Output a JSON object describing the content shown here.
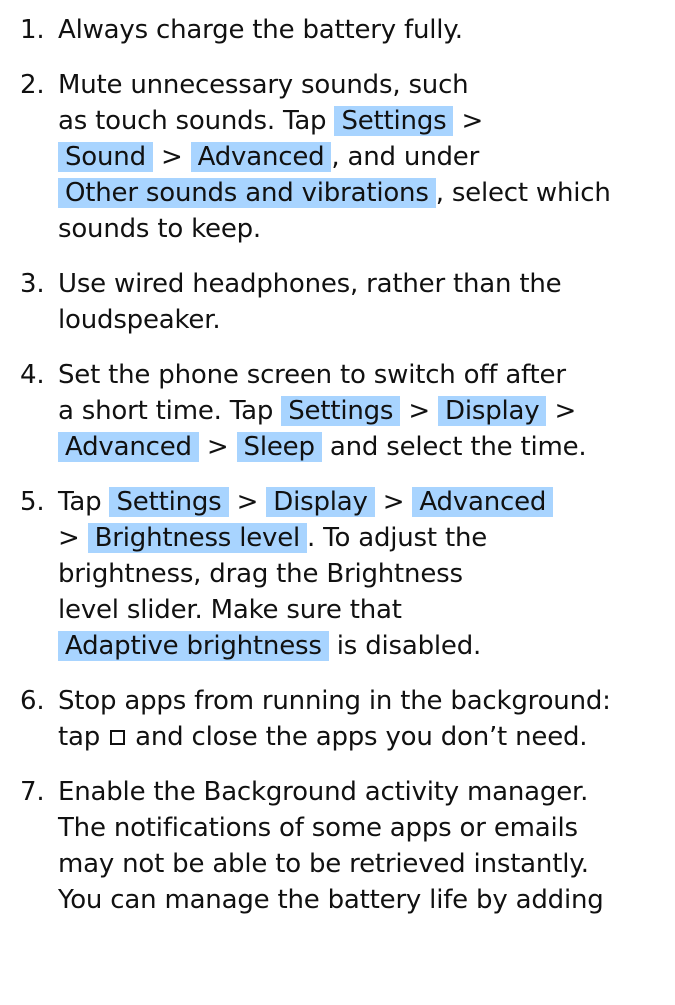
{
  "tips": [
    {
      "number": "1.",
      "parts": [
        {
          "type": "text",
          "value": "Always charge the battery fully."
        }
      ]
    },
    {
      "number": "2.",
      "parts": [
        {
          "type": "text",
          "value": "Mute unnecessary sounds, such\nas touch sounds. Tap "
        },
        {
          "type": "ui",
          "value": "Settings"
        },
        {
          "type": "text",
          "value": " >\n"
        },
        {
          "type": "ui",
          "value": "Sound"
        },
        {
          "type": "text",
          "value": " > "
        },
        {
          "type": "ui",
          "value": "Advanced"
        },
        {
          "type": "text",
          "value": ", and under\n"
        },
        {
          "type": "ui",
          "value": "Other sounds and vibrations"
        },
        {
          "type": "text",
          "value": ", select which\nsounds to keep."
        }
      ]
    },
    {
      "number": "3.",
      "parts": [
        {
          "type": "text",
          "value": "Use wired headphones, rather than the\nloudspeaker."
        }
      ]
    },
    {
      "number": "4.",
      "parts": [
        {
          "type": "text",
          "value": "Set the phone screen to switch off after\na short time. Tap "
        },
        {
          "type": "ui",
          "value": "Settings"
        },
        {
          "type": "text",
          "value": " > "
        },
        {
          "type": "ui",
          "value": "Display"
        },
        {
          "type": "text",
          "value": " >\n"
        },
        {
          "type": "ui",
          "value": "Advanced"
        },
        {
          "type": "text",
          "value": " > "
        },
        {
          "type": "ui",
          "value": "Sleep"
        },
        {
          "type": "text",
          "value": " and select the time."
        }
      ]
    },
    {
      "number": "5.",
      "parts": [
        {
          "type": "text",
          "value": "Tap "
        },
        {
          "type": "ui",
          "value": "Settings"
        },
        {
          "type": "text",
          "value": " > "
        },
        {
          "type": "ui",
          "value": "Display"
        },
        {
          "type": "text",
          "value": " > "
        },
        {
          "type": "ui",
          "value": "Advanced"
        },
        {
          "type": "text",
          "value": "\n> "
        },
        {
          "type": "ui",
          "value": "Brightness level"
        },
        {
          "type": "text",
          "value": ". To adjust the\nbrightness, drag the Brightness\nlevel slider. Make sure that\n"
        },
        {
          "type": "ui",
          "value": "Adaptive brightness"
        },
        {
          "type": "text",
          "value": " is disabled."
        }
      ]
    },
    {
      "number": "6.",
      "parts": [
        {
          "type": "text",
          "value": "Stop apps from running in the background:\ntap "
        },
        {
          "type": "icon",
          "value": "square-icon"
        },
        {
          "type": "text",
          "value": " and close the apps you don’t need."
        }
      ]
    },
    {
      "number": "7.",
      "parts": [
        {
          "type": "text",
          "value": "Enable the Background activity manager.\nThe notifications of some apps or emails\nmay not be able to be retrieved instantly.\nYou can manage the battery life by adding"
        }
      ]
    }
  ],
  "colors": {
    "highlight": "#a8d4ff",
    "text": "#111111",
    "background": "#ffffff"
  }
}
